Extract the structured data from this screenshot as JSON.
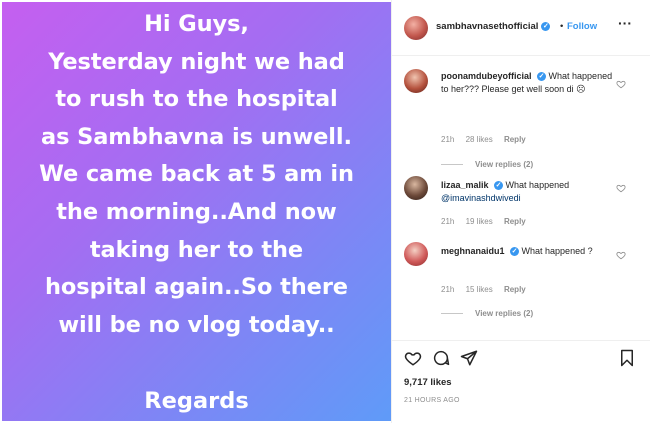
{
  "post": {
    "lines": [
      "Hi Guys,",
      "Yesterday night we had",
      "to rush to the hospital",
      "as Sambhavna is unwell.",
      "We came back at 5 am in",
      "the morning..And now",
      "taking her to the",
      "hospital again..So  there",
      "will be no vlog today.."
    ],
    "regards": "Regards"
  },
  "header": {
    "username": "sambhavnasethofficial",
    "verified_icon": "check",
    "separator": "•",
    "follow_label": "Follow",
    "more_label": "···"
  },
  "comments": [
    {
      "username": "poonamdubeyofficial",
      "verified": true,
      "text": " What happened to her??? Please get well soon di ☹",
      "time": "21h",
      "likes": "28 likes",
      "reply": "Reply",
      "view_replies": "View replies (2)"
    },
    {
      "username": "lizaa_malik",
      "verified": true,
      "text": " What happened ",
      "mention": "@imavinashdwivedi",
      "time": "21h",
      "likes": "19 likes",
      "reply": "Reply"
    },
    {
      "username": "meghnanaidu1",
      "verified": true,
      "text": " What happened ?",
      "time": "21h",
      "likes": "15 likes",
      "reply": "Reply",
      "view_replies": "View replies (2)"
    }
  ],
  "actions": {
    "likes": "9,717 likes",
    "timestamp": "21 HOURS AGO"
  },
  "icons": {
    "like": "heart-icon",
    "comment": "comment-icon",
    "share": "share-icon",
    "save": "bookmark-icon",
    "comment_like": "heart-outline-icon"
  },
  "colors": {
    "accent": "#3897f0",
    "gradient_start": "#c55ff0",
    "gradient_end": "#5f9bf8"
  }
}
